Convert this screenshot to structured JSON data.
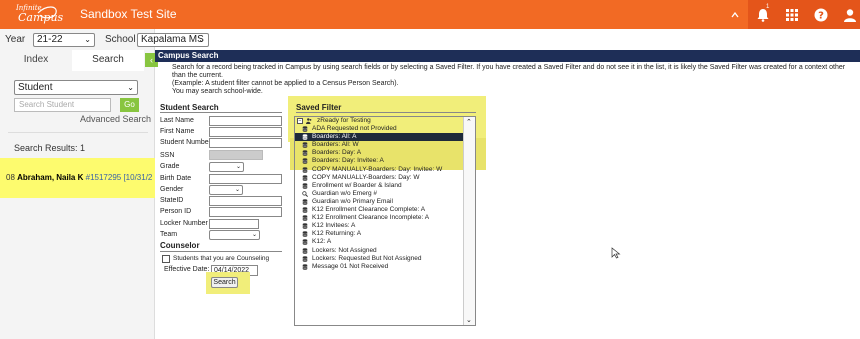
{
  "topbar": {
    "logo_line1": "Infinite",
    "logo_line2": "Campus",
    "site_title": "Sandbox Test Site",
    "bell_badge": "1",
    "accent": "#f26a24"
  },
  "context": {
    "year_label": "Year",
    "year_value": "21-22",
    "school_label": "School",
    "school_value": "Kapalama MS"
  },
  "tabs": {
    "index": "Index",
    "search": "Search",
    "collapse": "‹"
  },
  "left": {
    "search_type": "Student",
    "search_placeholder": "Search Student",
    "go": "Go",
    "advanced": "Advanced Search",
    "results_label": "Search Results: 1",
    "result_grade": "08",
    "result_name": "Abraham, Naila K",
    "result_id": "#1517295",
    "result_date": "[10/31/2"
  },
  "main": {
    "header": "Campus Search",
    "instructions_1": "Search for a record being tracked in Campus by using search fields or by selecting a Saved Filter. If you have created a Saved Filter and do not see it in the list, it is likely the Saved Filter was created for a context other than the current.",
    "instructions_2": "(Example: A student filter cannot be applied to a Census Person Search).",
    "instructions_3": "You may search school-wide."
  },
  "student_search": {
    "title": "Student Search",
    "fields": [
      "Last Name",
      "First Name",
      "Student Number",
      "SSN",
      "Grade",
      "Birth Date",
      "Gender",
      "StateID",
      "Person ID",
      "Locker Number",
      "Team"
    ],
    "counselor_title": "Counselor",
    "counsel_checkbox": "Students that you are Counseling",
    "effective_label": "Effective Date:",
    "effective_value": "04/14/2022",
    "search_button": "Search"
  },
  "saved_filter": {
    "title": "Saved Filter",
    "group": "zReady for Testing",
    "items": [
      "ADA Requested not Provided",
      "Boarders: All: A",
      "Boarders: All: W",
      "Boarders: Day: A",
      "Boarders: Day: Invitee: A",
      "COPY MANUALLY-Boarders: Day: Invitee: W",
      "COPY MANUALLY-Boarders: Day: W",
      "Enrollment w/ Boarder & Island",
      "Guardian w/o Emerg #",
      "Guardian w/o Primary Email",
      "K12 Enrollment Clearance Complete: A",
      "K12 Enrollment Clearance Incomplete: A",
      "K12 Invitees: A",
      "K12 Returning: A",
      "K12: A",
      "Lockers: Not Assigned",
      "Lockers: Requested But Not Assigned",
      "Message 01 Not Received"
    ],
    "selected_index": 1,
    "query_index": 8
  }
}
